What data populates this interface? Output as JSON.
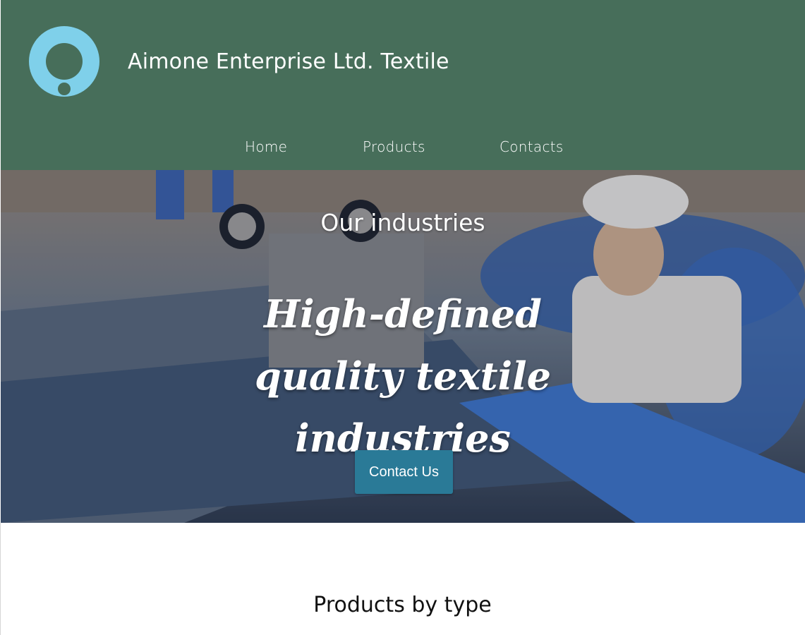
{
  "header": {
    "site_title": "Aimone Enterprise Ltd. Textile",
    "logo_icon": "ring-logo-icon",
    "logo_color": "#7fd0ea",
    "background_color": "#476e5a"
  },
  "nav": {
    "items": [
      {
        "label": "Home"
      },
      {
        "label": "Products"
      },
      {
        "label": "Contacts"
      }
    ]
  },
  "hero": {
    "subtitle": "Our industries",
    "title": "High-defined quality textile industries",
    "cta_label": "Contact Us",
    "cta_color": "#2a7a97"
  },
  "products_section": {
    "title": "Products by type"
  }
}
